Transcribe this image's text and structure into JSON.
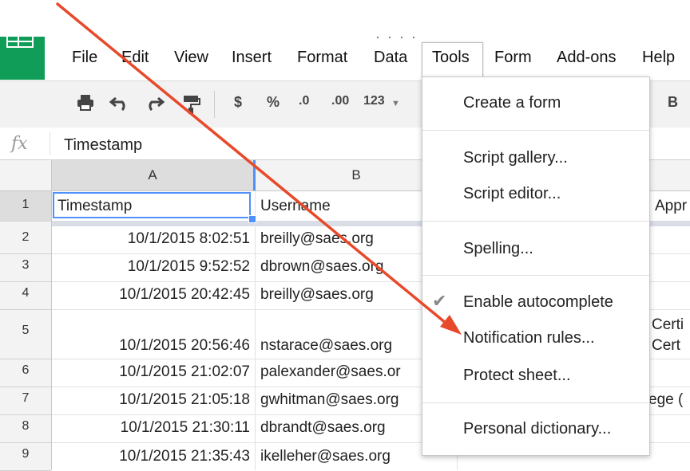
{
  "menubar": {
    "title_fragment": "· ·   ·  ·",
    "items": [
      "File",
      "Edit",
      "View",
      "Insert",
      "Format",
      "Data",
      "Tools",
      "Form",
      "Add-ons",
      "Help"
    ]
  },
  "toolbar": {
    "dollar": "$",
    "percent": "%",
    "dec_decrease": ".0",
    "dec_increase": ".00",
    "number_format": "123",
    "bold": "B"
  },
  "formula_bar": {
    "fx_label": "fx",
    "value": "Timestamp"
  },
  "columns": [
    "A",
    "B"
  ],
  "rows": [
    {
      "num": "1",
      "a": "Timestamp",
      "b": "Username",
      "c": "Appr"
    },
    {
      "num": "2",
      "a": "10/1/2015 8:02:51",
      "b": "breilly@saes.org",
      "c": ""
    },
    {
      "num": "3",
      "a": "10/1/2015 9:52:52",
      "b": "dbrown@saes.org",
      "c": ""
    },
    {
      "num": "4",
      "a": "10/1/2015 20:42:45",
      "b": "breilly@saes.org",
      "c": ""
    },
    {
      "num": "5",
      "a": "10/1/2015 20:56:46",
      "b": "nstarace@saes.org",
      "c": "Certi",
      "c2": "Cert"
    },
    {
      "num": "6",
      "a": "10/1/2015 21:02:07",
      "b": "palexander@saes.or",
      "c": ""
    },
    {
      "num": "7",
      "a": "10/1/2015 21:05:18",
      "b": "gwhitman@saes.org",
      "c": "ege ("
    },
    {
      "num": "8",
      "a": "10/1/2015 21:30:11",
      "b": "dbrandt@saes.org",
      "c": ""
    },
    {
      "num": "9",
      "a": "10/1/2015 21:35:43",
      "b": "ikelleher@saes.org",
      "c": ""
    }
  ],
  "tools_menu": {
    "items": [
      "Create a form",
      "Script gallery...",
      "Script editor...",
      "Spelling...",
      "Enable autocomplete",
      "Notification rules...",
      "Protect sheet...",
      "Personal dictionary..."
    ],
    "checked_item": "Enable autocomplete"
  },
  "colors": {
    "arrow": "#e8492b",
    "selection": "#4d90fe",
    "logo": "#0f9d58"
  }
}
